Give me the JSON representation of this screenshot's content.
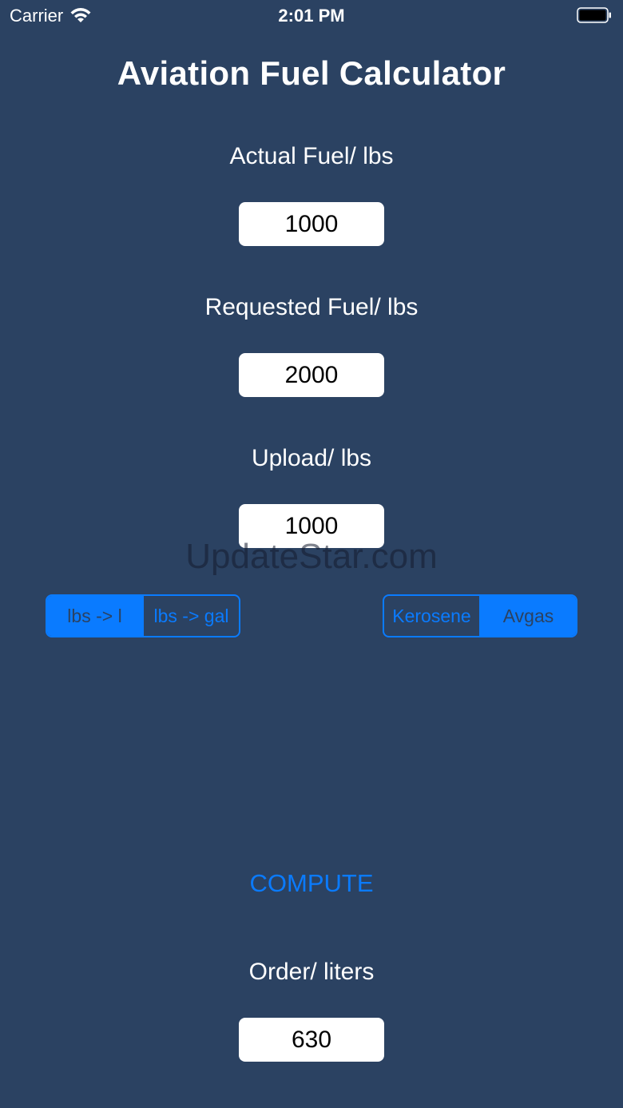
{
  "status_bar": {
    "carrier": "Carrier",
    "time": "2:01 PM"
  },
  "title": "Aviation Fuel Calculator",
  "fields": {
    "actual": {
      "label": "Actual Fuel/ lbs",
      "value": "1000"
    },
    "requested": {
      "label": "Requested Fuel/ lbs",
      "value": "2000"
    },
    "upload": {
      "label": "Upload/ lbs",
      "value": "1000"
    }
  },
  "watermark": "UpdateStar.com",
  "unit_segment": {
    "options": [
      "lbs -> l",
      "lbs -> gal"
    ],
    "selected": "lbs -> l"
  },
  "fuel_segment": {
    "options": [
      "Kerosene",
      "Avgas"
    ],
    "selected": "Avgas"
  },
  "compute_label": "COMPUTE",
  "order": {
    "label": "Order/ liters",
    "value": "630"
  },
  "colors": {
    "background": "#2b4262",
    "accent": "#0a7bff",
    "text": "#ffffff"
  }
}
